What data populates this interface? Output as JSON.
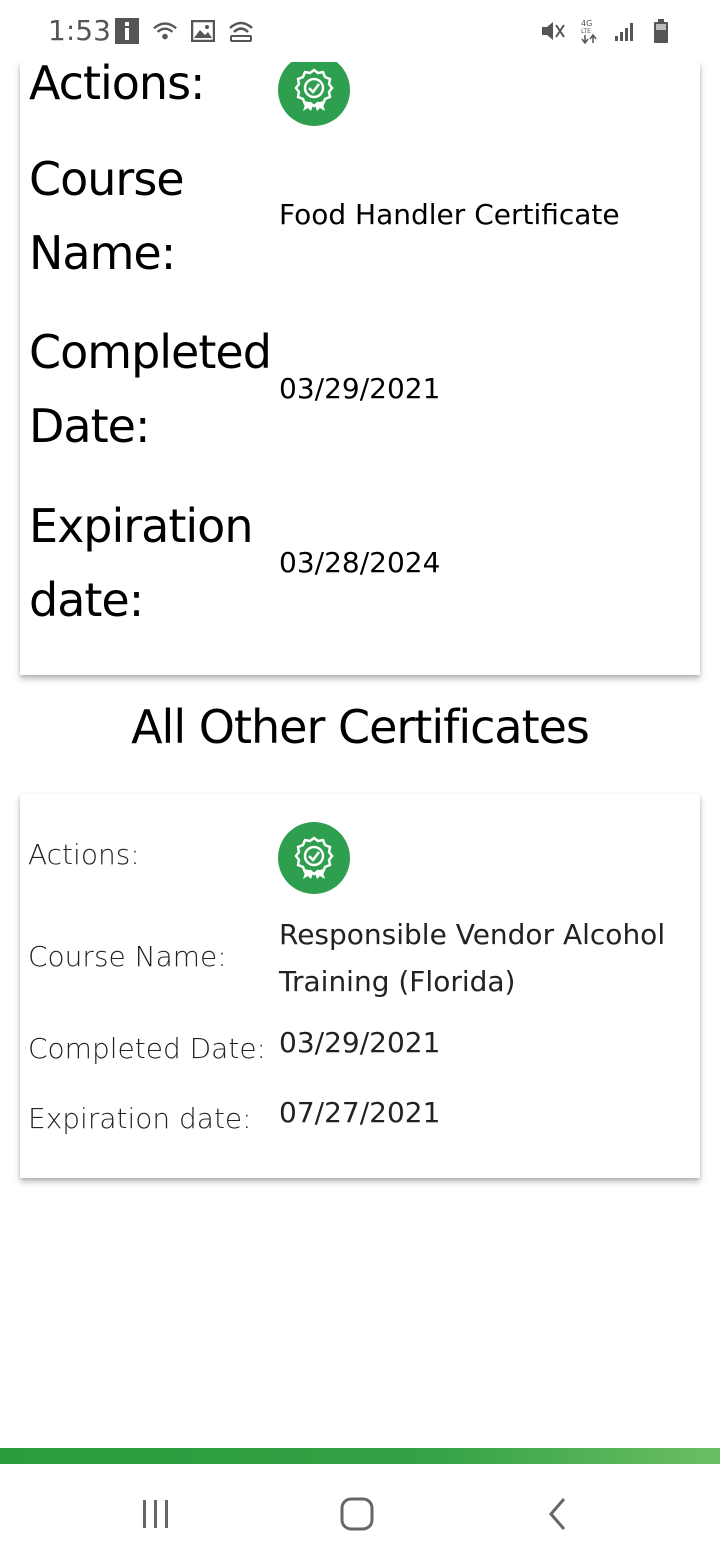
{
  "status_bar": {
    "time": "1:53",
    "left_icons": [
      "info-icon",
      "wifi-calling-icon",
      "image-icon",
      "hotspot-icon"
    ],
    "right_icons": [
      "mute-icon",
      "4g-lte-icon",
      "signal-icon",
      "battery-icon"
    ]
  },
  "primary_certificate": {
    "actions_label": "Actions:",
    "course_name_label": "Course Name:",
    "course_name_line1": "Course",
    "course_name_line2": "Name:",
    "course_name": "Food Handler Certificate",
    "completed_label_line1": "Completed",
    "completed_label_line2": "Date:",
    "completed_date": "03/29/2021",
    "expiration_label_line1": "Expiration",
    "expiration_label_line2": "date:",
    "expiration_date": "03/28/2024"
  },
  "other_section": {
    "title": "All Other Certificates"
  },
  "other_certificates": [
    {
      "actions_label": "Actions:",
      "course_name_label": "Course Name:",
      "course_name_line1": "Responsible Vendor Alcohol",
      "course_name_line2": "Training (Florida)",
      "completed_label": "Completed Date:",
      "completed_date": "03/29/2021",
      "expiration_label": "Expiration date:",
      "expiration_date": "07/27/2021"
    }
  ],
  "colors": {
    "badge": "#2e9e4f",
    "bar_start": "#2a9d3c",
    "bar_end": "#6bbf63"
  },
  "nav": {
    "icons": [
      "recent-apps-icon",
      "home-icon",
      "back-icon"
    ]
  }
}
